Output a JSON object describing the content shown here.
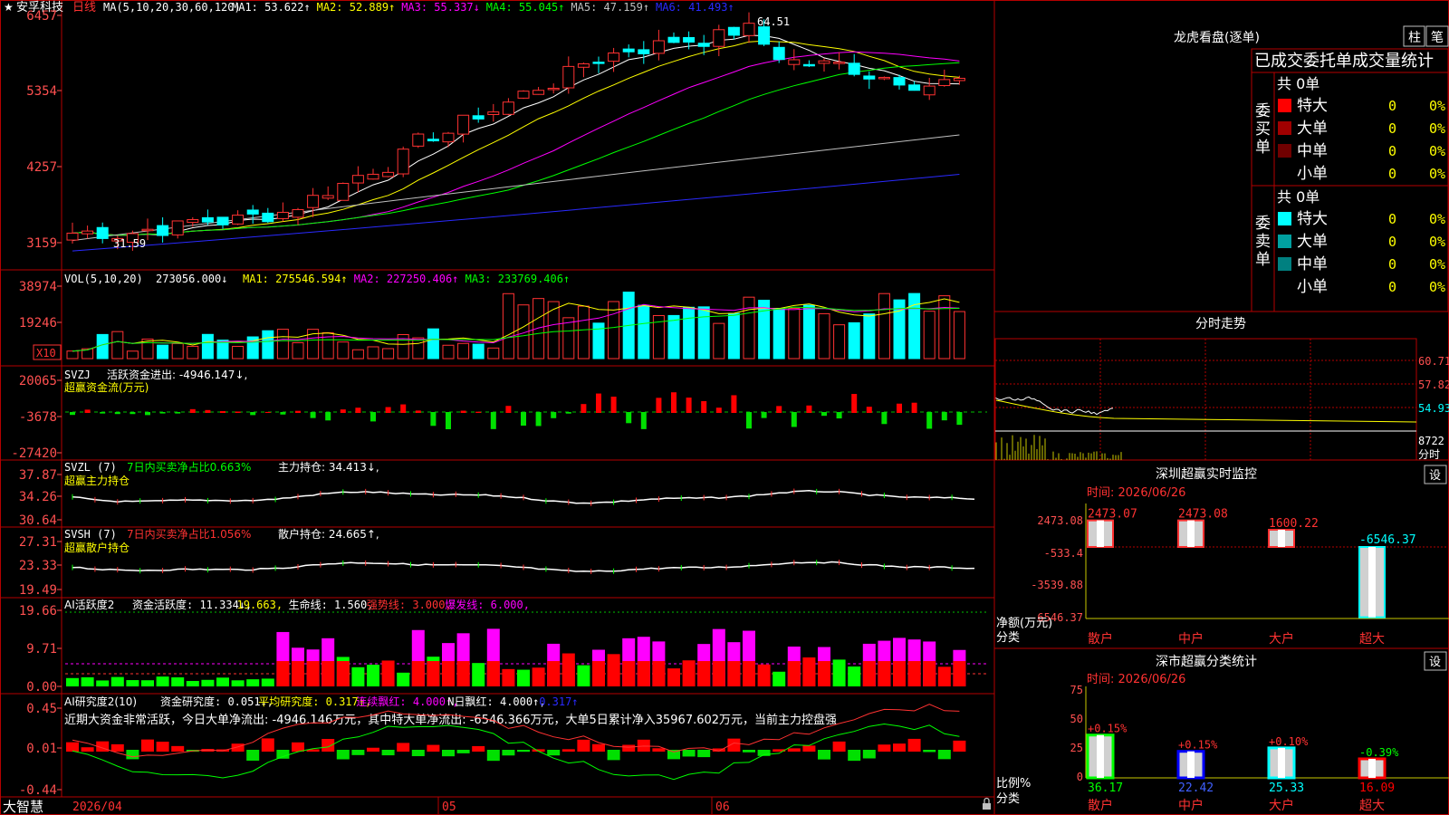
{
  "colors": {
    "up": "#ff3232",
    "down": "#00ffff",
    "grid": "#b40000",
    "axis": "#ff5050",
    "label": "#c0c0c0"
  },
  "icons": [
    "star-icon",
    "settings-icon",
    "lock-icon"
  ],
  "kline": {
    "star": "★",
    "stock_name": "安孚科技",
    "period": "日线",
    "ma_label": "MA(5,10,20,30,60,120)",
    "ma_values": [
      {
        "label": "MA1: 53.622↑",
        "color": "#ffffff"
      },
      {
        "label": "MA2: 52.889↑",
        "color": "#ffff00"
      },
      {
        "label": "MA3: 55.337↓",
        "color": "#ff00ff"
      },
      {
        "label": "MA4: 55.045↑",
        "color": "#00ff00"
      },
      {
        "label": "MA5: 47.159↑",
        "color": "#c0c0c0"
      },
      {
        "label": "MA6: 41.493↑",
        "color": "#2a2aff"
      }
    ],
    "y_ticks": [
      "6457",
      "5354",
      "4257",
      "3159"
    ],
    "high_label": "64.51",
    "low_label": "31.59"
  },
  "vol": {
    "title": "VOL(5,10,20)",
    "value": "273056.000↓",
    "mas": [
      {
        "label": "MA1: 275546.594↑",
        "color": "#ffff00"
      },
      {
        "label": "MA2: 227250.406↑",
        "color": "#ff00ff"
      },
      {
        "label": "MA3: 233769.406↑",
        "color": "#00ff00"
      }
    ],
    "y_ticks": [
      "38974",
      "19246"
    ],
    "unit": "X10"
  },
  "svzj": {
    "title": "SVZJ",
    "line1": "活跃资金进出: -4946.147↓,",
    "line2": "超赢资金流(万元)",
    "y_ticks": [
      "20065",
      "-3678",
      "-27420"
    ]
  },
  "svzl": {
    "title": "SVZL (7)",
    "line1": "7日内买卖净占比0.663%",
    "line1b": "主力持仓: 34.413↓,",
    "line2": "超赢主力持仓",
    "y_ticks": [
      "37.87",
      "34.26",
      "30.64"
    ]
  },
  "svsh": {
    "title": "SVSH (7)",
    "line1": "7日内买卖净占比1.056%",
    "line1b": "散户持仓: 24.665↑,",
    "line2": "超赢散户持仓",
    "y_ticks": [
      "27.31",
      "23.33",
      "19.49"
    ]
  },
  "ai_active": {
    "title": "AI活跃度2",
    "values": [
      {
        "label": "资金活跃度: 11.334↓,",
        "color": "#ffffff"
      },
      {
        "label": "19.663,",
        "color": "#ffff00"
      },
      {
        "label": "生命线: 1.560,",
        "color": "#ffffff"
      },
      {
        "label": "强势线: 3.000,",
        "color": "#ff3232"
      },
      {
        "label": "爆发线: 6.000,",
        "color": "#ff00ff"
      }
    ],
    "y_ticks": [
      "19.66",
      "9.71",
      "0.00"
    ]
  },
  "ai_research": {
    "title": "AI研究度2(10)",
    "values": [
      {
        "label": "资金研究度: 0.051↓,",
        "color": "#ffffff"
      },
      {
        "label": "平均研究度: 0.317↑,",
        "color": "#ffff00"
      },
      {
        "label": "连续飘红: 4.000↑,",
        "color": "#ff00ff"
      },
      {
        "label": "N日飘红: 4.000↑,",
        "color": "#ffffff"
      },
      {
        "label": "0.317↑",
        "color": "#2a2aff"
      }
    ],
    "summary": "近期大资金非常活跃，今日大单净流出: -4946.146万元，其中特大单净流出: -6546.366万元，大单5日累计净入35967.602万元，当前主力控盘强",
    "y_ticks": [
      "0.45",
      "0.01",
      "-0.44"
    ]
  },
  "bottom": {
    "brand": "大智慧",
    "date": "2026/04",
    "month1": "05",
    "month2": "06"
  },
  "dragon": {
    "title": "龙虎看盘(逐单)",
    "tab_zhu": "柱",
    "tab_bi": "笔",
    "header": "已成交委托单成交量统计",
    "buy_label": "委买单",
    "sell_label": "委卖单",
    "buy_total": "共 0单",
    "sell_total": "共 0单",
    "buy_rows": [
      {
        "name": "特大",
        "count": "0",
        "pct": "0%",
        "color": "#ff0000"
      },
      {
        "name": "大单",
        "count": "0",
        "pct": "0%",
        "color": "#a00000"
      },
      {
        "name": "中单",
        "count": "0",
        "pct": "0%",
        "color": "#700000"
      },
      {
        "name": "小单",
        "count": "0",
        "pct": "0%",
        "color": "#000000"
      }
    ],
    "sell_rows": [
      {
        "name": "特大",
        "count": "0",
        "pct": "0%",
        "color": "#00ffff"
      },
      {
        "name": "大单",
        "count": "0",
        "pct": "0%",
        "color": "#00a0a0"
      },
      {
        "name": "中单",
        "count": "0",
        "pct": "0%",
        "color": "#008080"
      },
      {
        "name": "小单",
        "count": "0",
        "pct": "0%",
        "color": "#000000"
      }
    ]
  },
  "intraday": {
    "title": "分时走势",
    "y_ticks": [
      "60.71",
      "57.82",
      "54.93",
      "8722"
    ],
    "time_label": "分时"
  },
  "sz_monitor": {
    "title": "深圳超赢实时监控",
    "settings": "设",
    "time": "时间: 2026/06/26",
    "y_ticks": [
      "2473.08",
      "-533.4",
      "-3539.88",
      "-6546.37"
    ],
    "side_label1": "净额(万元)",
    "side_label2": "分类",
    "chart_data": {
      "type": "bar",
      "categories": [
        "散户",
        "中户",
        "大户",
        "超大"
      ],
      "values": [
        2473.07,
        2473.08,
        1600.22,
        -6546.37
      ],
      "labels": [
        "2473.07",
        "2473.08",
        "1600.22",
        "-6546.37"
      ],
      "ylim": [
        -6546.37,
        2473.08
      ]
    }
  },
  "sz_class": {
    "title": "深市超赢分类统计",
    "settings": "设",
    "time": "时间: 2026/06/26",
    "y_ticks": [
      "75",
      "50",
      "25",
      "0"
    ],
    "side_label1": "比例%",
    "side_label2": "分类",
    "chart_data": {
      "type": "bar",
      "categories": [
        "散户",
        "中户",
        "大户",
        "超大"
      ],
      "values": [
        36.17,
        22.42,
        25.33,
        16.09
      ],
      "changes": [
        "+0.15%",
        "+0.15%",
        "+0.10%",
        "-0.39%"
      ],
      "ylim": [
        0,
        75
      ]
    }
  }
}
